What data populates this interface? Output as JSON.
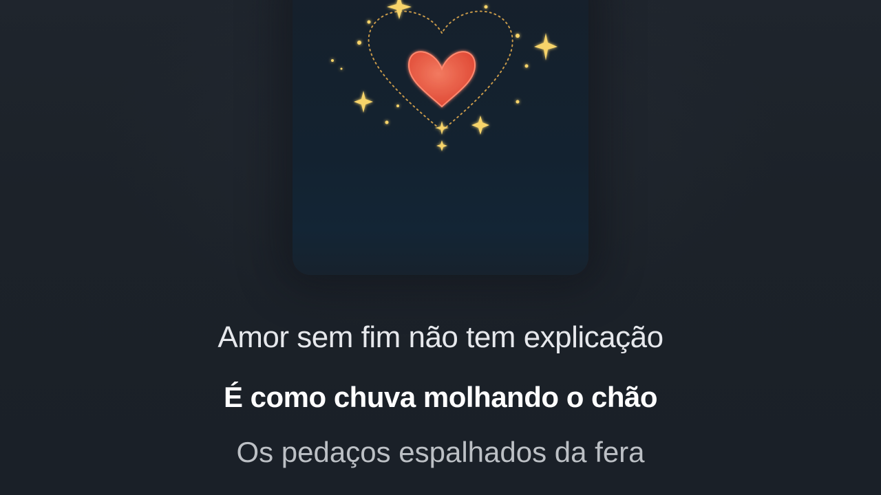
{
  "artwork": {
    "icon": "heart-sparkles-icon",
    "heart_color": "#e85a45",
    "sparkle_color": "#f7d46a"
  },
  "lyrics": {
    "previous_line": "Amor sem fim não tem explicação",
    "current_line": "É como chuva molhando o chão",
    "next_line": "Os pedaços espalhados da fera"
  }
}
